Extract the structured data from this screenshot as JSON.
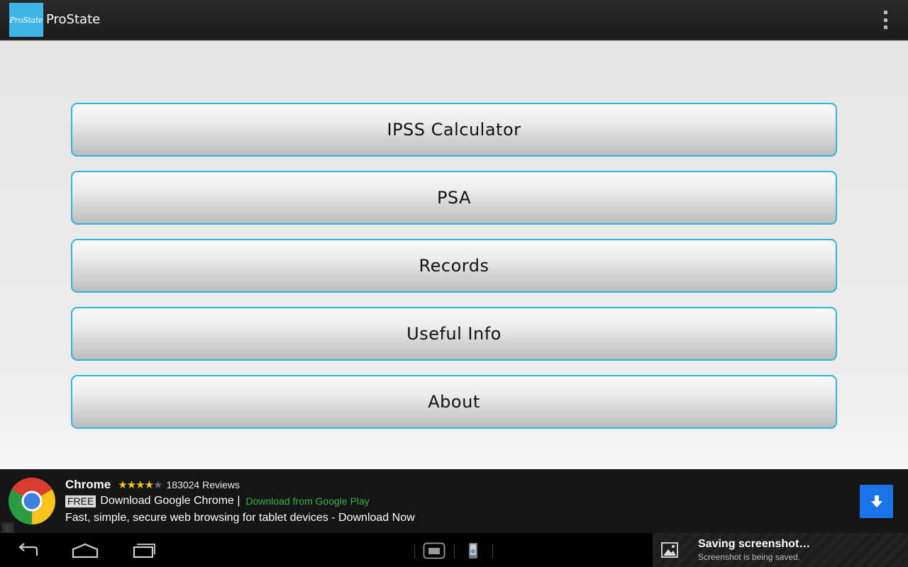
{
  "actionbar": {
    "app_icon_text": "ProState",
    "title": "ProState",
    "overflow_icon": "overflow-menu-icon"
  },
  "menu": {
    "items": [
      {
        "label": "IPSS Calculator"
      },
      {
        "label": "PSA"
      },
      {
        "label": "Records"
      },
      {
        "label": "Useful Info"
      },
      {
        "label": "About"
      }
    ]
  },
  "ad": {
    "name": "Chrome",
    "rating": 4,
    "rating_max": 5,
    "reviews": "183024 Reviews",
    "free_badge": "FREE",
    "headline": "Download Google Chrome |",
    "link": "Download from Google Play",
    "description": "Fast, simple, secure web browsing for tablet devices - Download Now",
    "info_icon": "ⓘ"
  },
  "notification": {
    "title": "Saving screenshot…",
    "subtitle": "Screenshot is being saved."
  },
  "colors": {
    "accent": "#2fb3e1",
    "download_button": "#1a73e8",
    "link_green": "#35b34a",
    "star": "#f2c71b"
  }
}
